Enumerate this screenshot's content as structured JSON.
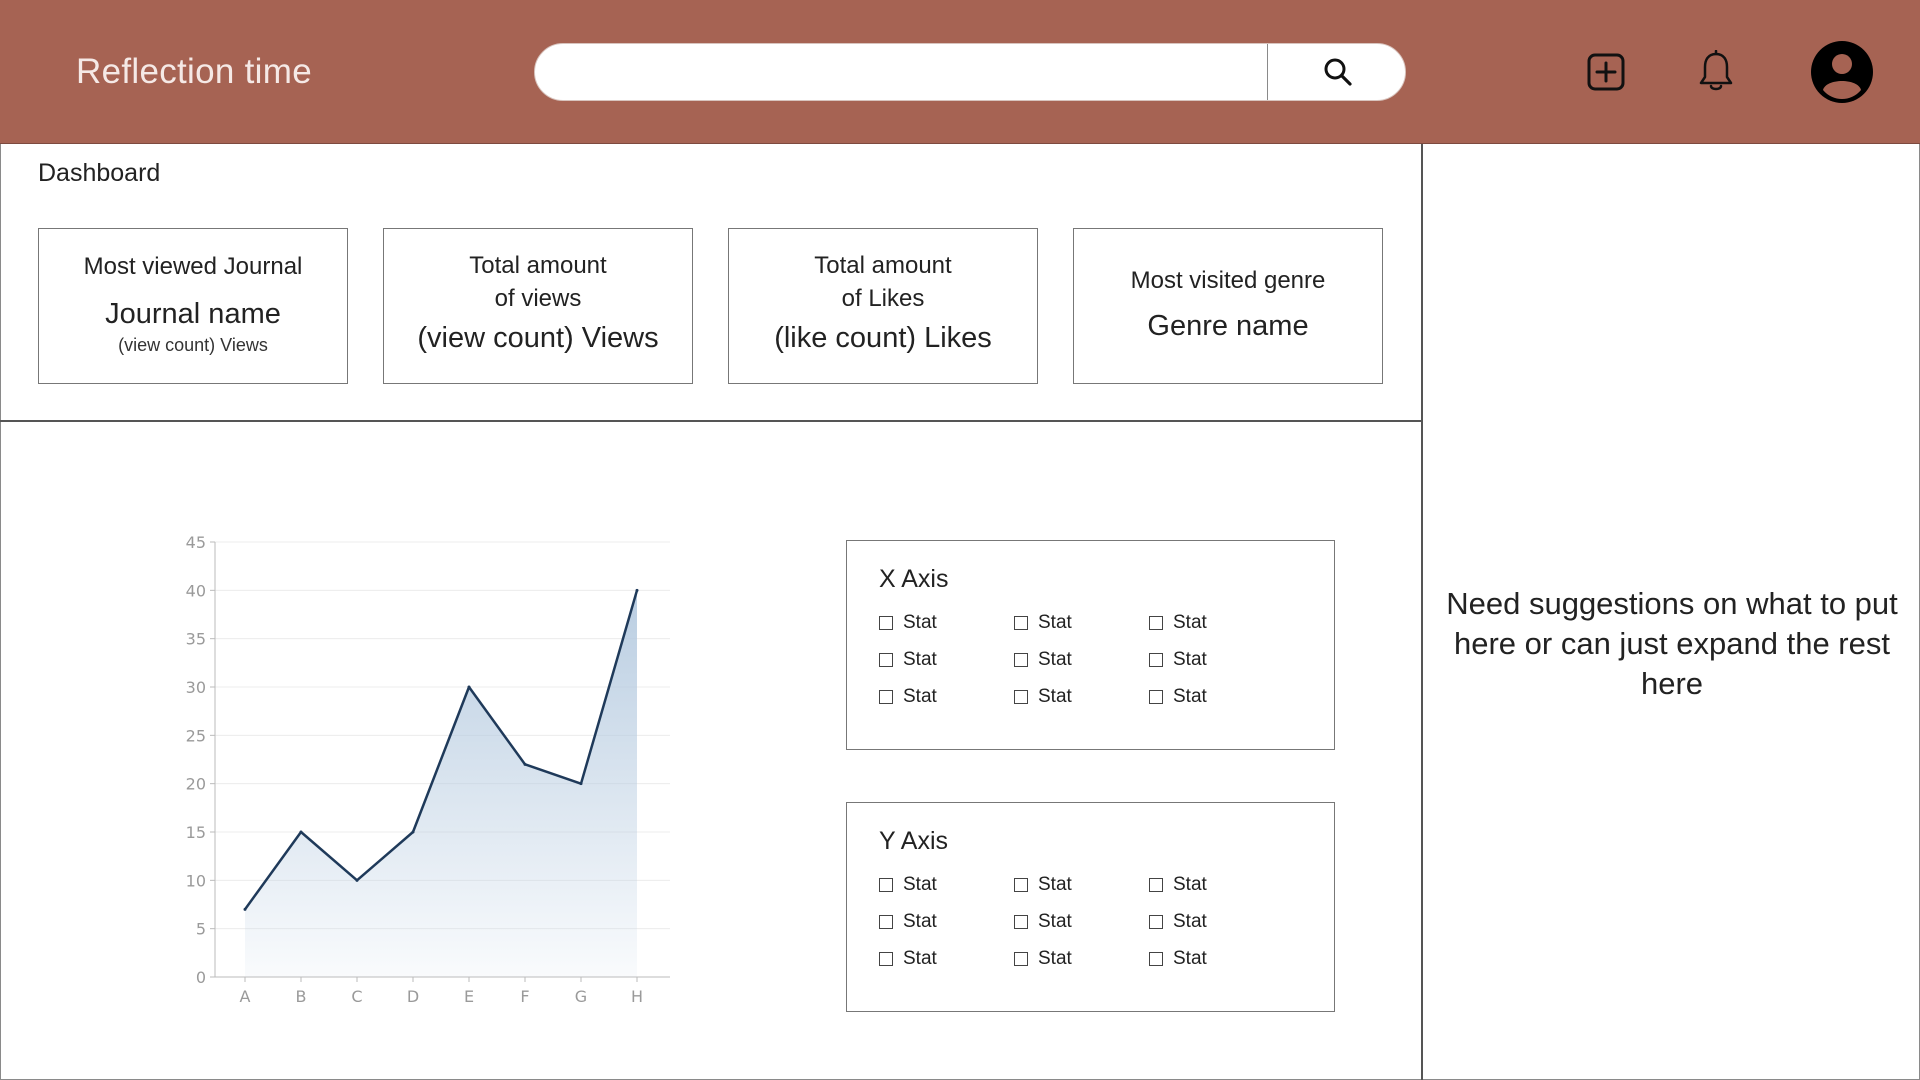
{
  "header": {
    "title": "Reflection time",
    "search_placeholder": "",
    "icons": [
      "search-icon",
      "add-square-icon",
      "bell-icon",
      "user-avatar-icon"
    ],
    "bar_color": "#a66353"
  },
  "dashboard": {
    "title": "Dashboard",
    "cards": [
      {
        "label": "Most viewed Journal",
        "value": "Journal name",
        "sub": "(view count) Views"
      },
      {
        "label_line1": "Total amount",
        "label_line2": "of views",
        "value": "(view count) Views"
      },
      {
        "label_line1": "Total amount",
        "label_line2": "of Likes",
        "value": "(like count) Likes"
      },
      {
        "label": "Most visited genre",
        "value": "Genre name"
      }
    ]
  },
  "chart_data": {
    "type": "area",
    "categories": [
      "A",
      "B",
      "C",
      "D",
      "E",
      "F",
      "G",
      "H"
    ],
    "values": [
      7,
      15,
      10,
      15,
      30,
      22,
      20,
      40
    ],
    "ylim": [
      0,
      45
    ],
    "yticks": [
      0,
      5,
      10,
      15,
      20,
      25,
      30,
      35,
      40,
      45
    ],
    "grid": true,
    "line_color": "#1f3a5a",
    "fill_color": "#b6cbe0"
  },
  "x_axis": {
    "title": "X Axis",
    "options": [
      "Stat",
      "Stat",
      "Stat",
      "Stat",
      "Stat",
      "Stat",
      "Stat",
      "Stat",
      "Stat"
    ]
  },
  "y_axis": {
    "title": "Y Axis",
    "options": [
      "Stat",
      "Stat",
      "Stat",
      "Stat",
      "Stat",
      "Stat",
      "Stat",
      "Stat",
      "Stat"
    ]
  },
  "side_panel": {
    "note": "Need suggestions on what to put here or can just expand the rest here"
  }
}
